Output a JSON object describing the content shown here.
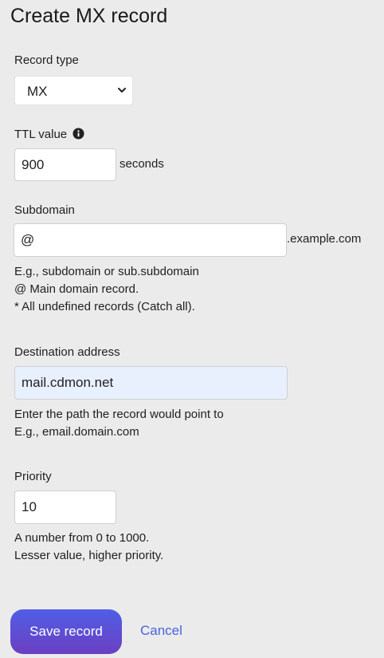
{
  "page": {
    "title": "Create MX record"
  },
  "record_type": {
    "label": "Record type",
    "value": "MX"
  },
  "ttl": {
    "label": "TTL value",
    "value": "900",
    "unit": "seconds",
    "info_icon": "info-icon"
  },
  "subdomain": {
    "label": "Subdomain",
    "value": "@",
    "suffix": ".example.com",
    "help": [
      "E.g., subdomain or sub.subdomain",
      "@ Main domain record.",
      "* All undefined records (Catch all)."
    ]
  },
  "destination": {
    "label": "Destination address",
    "value": "mail.cdmon.net",
    "help": [
      "Enter the path the record would point to",
      "E.g., email.domain.com"
    ]
  },
  "priority": {
    "label": "Priority",
    "value": "10",
    "help": [
      "A number from 0 to 1000.",
      "Lesser value, higher priority."
    ]
  },
  "actions": {
    "save_label": "Save record",
    "cancel_label": "Cancel"
  },
  "colors": {
    "background": "#ebebeb",
    "button_top": "#4f5fe6",
    "button_bottom": "#6b3fc2",
    "link": "#4a63e0",
    "autofill": "#e8f0fe"
  }
}
